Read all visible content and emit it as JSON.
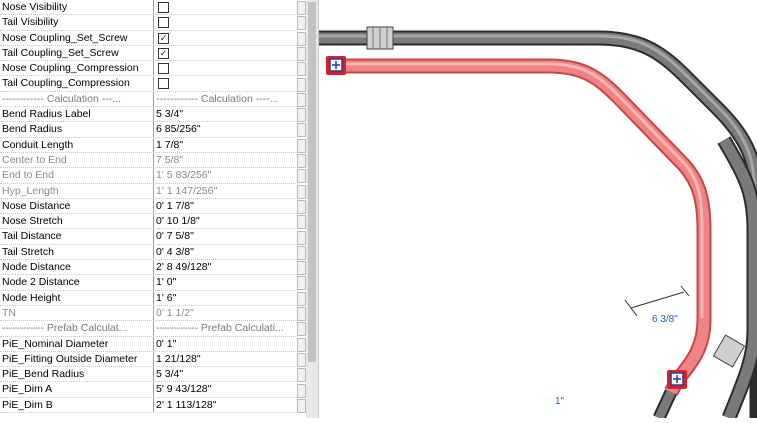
{
  "properties": [
    {
      "name": "Nose Visibility",
      "type": "checkbox",
      "checked": false
    },
    {
      "name": "Tail Visibility",
      "type": "checkbox",
      "checked": false
    },
    {
      "name": "Nose Coupling_Set_Screw",
      "type": "checkbox",
      "checked": true
    },
    {
      "name": "Tail Coupling_Set_Screw",
      "type": "checkbox",
      "checked": true
    },
    {
      "name": "Nose Coupling_Compression",
      "type": "checkbox",
      "checked": false
    },
    {
      "name": "Tail Coupling_Compression",
      "type": "checkbox",
      "checked": false
    },
    {
      "name": "------------ Calculation ---...",
      "value": "------------ Calculation ----...",
      "type": "header"
    },
    {
      "name": "Bend Radius Label",
      "value": "5 3/4\""
    },
    {
      "name": "Bend Radius",
      "value": "6 85/256\""
    },
    {
      "name": "Conduit Length",
      "value": "1 7/8\""
    },
    {
      "name": "Center to End",
      "value": "7 5/8\"",
      "style": "grey"
    },
    {
      "name": "End to End",
      "value": "1'  5 83/256\"",
      "style": "grey"
    },
    {
      "name": "Hyp_Length",
      "value": "1'  1 147/256\"",
      "style": "grey"
    },
    {
      "name": "Nose Distance",
      "value": "0'  1 7/8\""
    },
    {
      "name": "Nose Stretch",
      "value": "0'  10 1/8\""
    },
    {
      "name": "Tail Distance",
      "value": "0'  7 5/8\""
    },
    {
      "name": "Tail Stretch",
      "value": "0'  4 3/8\""
    },
    {
      "name": "Node Distance",
      "value": "2'  8 49/128\""
    },
    {
      "name": "Node 2 Distance",
      "value": "1'  0\""
    },
    {
      "name": "Node Height",
      "value": "1'  6\""
    },
    {
      "name": "TN",
      "value": "0'  1 1/2\"",
      "style": "grey"
    },
    {
      "name": "------------ Prefab Calculat...",
      "value": "------------ Prefab Calculati...",
      "type": "header"
    },
    {
      "name": "PiE_Nominal Diameter",
      "value": "0'  1\""
    },
    {
      "name": "PiE_Fitting Outside Diameter",
      "value": "1 21/128\""
    },
    {
      "name": "PiE_Bend Radius",
      "value": "5 3/4\""
    },
    {
      "name": "PiE_Dim A",
      "value": "5'  9 43/128\""
    },
    {
      "name": "PiE_Dim B",
      "value": "2'  1 113/128\""
    }
  ],
  "canvas": {
    "bend_dimension_label": "6 3/8\"",
    "diameter_label": "1\""
  },
  "colors": {
    "selected_conduit": "#f08383",
    "conduit": "#5a5a5a",
    "dimension_text": "#1f5fbf"
  }
}
